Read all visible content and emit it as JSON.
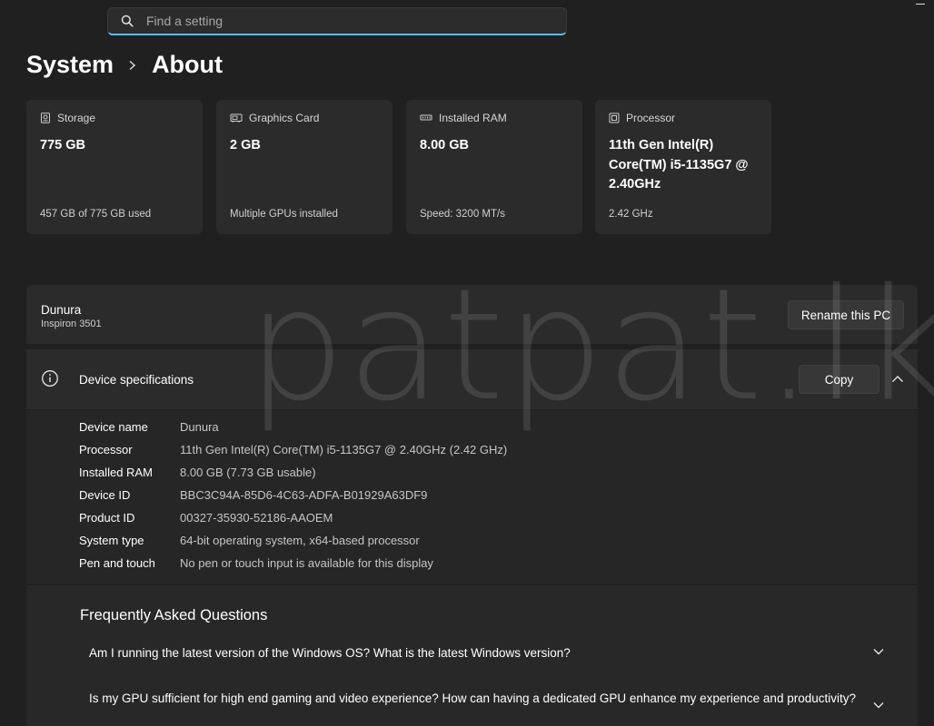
{
  "search": {
    "placeholder": "Find a setting"
  },
  "breadcrumb": {
    "parent": "System",
    "current": "About"
  },
  "cards": [
    {
      "icon": "storage-icon",
      "title": "Storage",
      "value": "775 GB",
      "sub": "457 GB of 775 GB used"
    },
    {
      "icon": "graphics-card-icon",
      "title": "Graphics Card",
      "value": "2 GB",
      "sub": "Multiple GPUs installed"
    },
    {
      "icon": "ram-icon",
      "title": "Installed RAM",
      "value": "8.00 GB",
      "sub": "Speed: 3200 MT/s"
    },
    {
      "icon": "processor-icon",
      "title": "Processor",
      "value": "11th Gen Intel(R) Core(TM) i5-1135G7 @ 2.40GHz",
      "sub": "2.42 GHz"
    }
  ],
  "pc": {
    "name": "Dunura",
    "model": "Inspiron 3501",
    "rename_label": "Rename this PC"
  },
  "specs": {
    "title": "Device specifications",
    "copy_label": "Copy",
    "rows": [
      {
        "label": "Device name",
        "value": "Dunura"
      },
      {
        "label": "Processor",
        "value": "11th Gen Intel(R) Core(TM) i5-1135G7 @ 2.40GHz (2.42 GHz)"
      },
      {
        "label": "Installed RAM",
        "value": "8.00 GB (7.73 GB usable)"
      },
      {
        "label": "Device ID",
        "value": "BBC3C94A-85D6-4C63-ADFA-B01929A63DF9"
      },
      {
        "label": "Product ID",
        "value": "00327-35930-52186-AAOEM"
      },
      {
        "label": "System type",
        "value": "64-bit operating system, x64-based processor"
      },
      {
        "label": "Pen and touch",
        "value": "No pen or touch input is available for this display"
      }
    ]
  },
  "faq": {
    "title": "Frequently Asked Questions",
    "items": [
      "Am I running the latest version of the Windows OS? What is the latest Windows version?",
      "Is my GPU sufficient for high end gaming and video experience? How can having a dedicated GPU enhance my experience and productivity?"
    ]
  },
  "watermark": "patpat.lk",
  "colors": {
    "background": "#202020",
    "card": "#2b2b2b",
    "accent": "#4cc2ff"
  }
}
